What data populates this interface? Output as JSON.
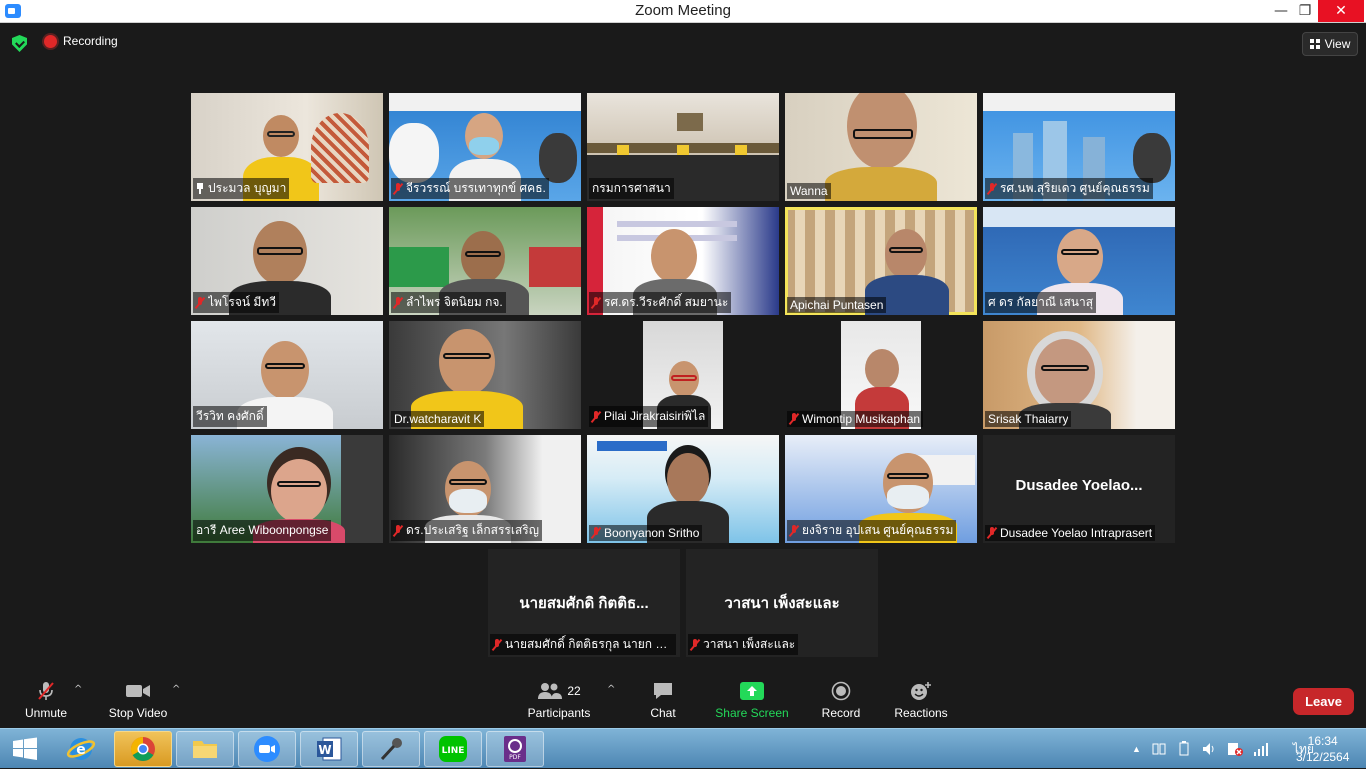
{
  "window": {
    "title": "Zoom Meeting",
    "minimize": "—",
    "maximize": "❐",
    "close": "✕"
  },
  "header": {
    "recording_label": "Recording",
    "view_label": "View"
  },
  "participants_tiles": [
    {
      "name": "ประมวล บุญมา",
      "status": "pinned"
    },
    {
      "name": "จีรวรรณ์ บรรเทาทุกข์ ศคธ.",
      "status": "muted"
    },
    {
      "name": "กรมการศาสนา",
      "status": "none"
    },
    {
      "name": "Wanna",
      "status": "none"
    },
    {
      "name": "รศ.นพ.สุริยเดว ศูนย์คุณธรรม",
      "status": "muted"
    },
    {
      "name": "ไพโรจน์ มีทวี",
      "status": "muted"
    },
    {
      "name": "ลำไพร จิตนิยม กจ.",
      "status": "muted"
    },
    {
      "name": "รศ.ดร.วีระศักดิ์ สมยานะ",
      "status": "muted"
    },
    {
      "name": "Apichai Puntasen",
      "status": "none"
    },
    {
      "name": "ศ ดร กัลยาณี เสนาสุ",
      "status": "none"
    },
    {
      "name": "วีรวิท คงศักดิ์",
      "status": "none"
    },
    {
      "name": "Dr.watcharavit K",
      "status": "none"
    },
    {
      "name": "Pilai Jirakraisiriพิไล",
      "status": "muted"
    },
    {
      "name": "Wimontip Musikaphan",
      "status": "muted"
    },
    {
      "name": "Srisak Thaiarry",
      "status": "none"
    },
    {
      "name": "อารี Aree Wiboonpongse",
      "status": "none"
    },
    {
      "name": "ดร.ประเสริฐ เล็กสรรเสริญ",
      "status": "muted"
    },
    {
      "name": "Boonyanon Sritho",
      "status": "muted"
    },
    {
      "name": "ยงจิราย อุปเสน ศูนย์คุณธรรม",
      "status": "muted"
    },
    {
      "name": "Dusadee  Yoelao Intraprasert",
      "status": "muted",
      "avatar_text": "Dusadee   Yoelao..."
    },
    {
      "name": "นายสมศักดิ์ กิตติธรกุล นายก อบต.",
      "status": "muted",
      "avatar_text": "นายสมศักดิ กิตติธ..."
    },
    {
      "name": "วาสนา เพ็งสะและ",
      "status": "muted",
      "avatar_text": "วาสนา เพ็งสะและ"
    }
  ],
  "toolbar": {
    "unmute": "Unmute",
    "stop_video": "Stop Video",
    "participants": "Participants",
    "participants_count": "22",
    "chat": "Chat",
    "share_screen": "Share Screen",
    "record": "Record",
    "reactions": "Reactions",
    "leave": "Leave",
    "caret": "^"
  },
  "taskbar": {
    "language": "ไทย",
    "time": "16:34",
    "date": "3/12/2564",
    "tray_expand": "▲"
  },
  "colors": {
    "accent_green": "#23d959",
    "leave_red": "#c7272a",
    "muted_red": "#e02828",
    "active_speaker": "#f4e45a"
  }
}
